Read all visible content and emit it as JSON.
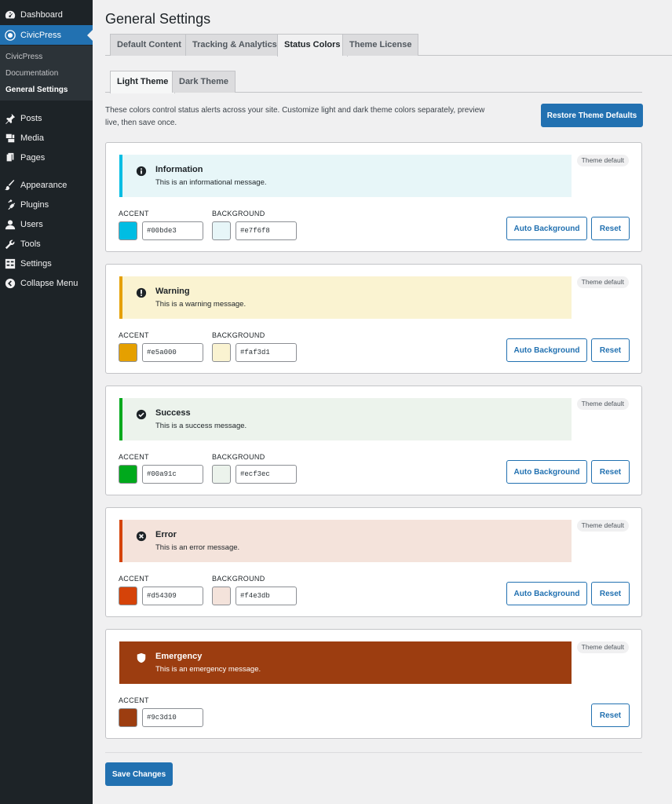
{
  "sidebar": {
    "items": [
      {
        "label": "Dashboard",
        "icon": "dashboard-icon"
      },
      {
        "label": "CivicPress",
        "icon": "civicpress-icon",
        "active": true
      }
    ],
    "submenu": [
      "CivicPress",
      "Documentation",
      "General Settings"
    ],
    "lower_items": [
      {
        "label": "Posts",
        "icon": "pin-icon"
      },
      {
        "label": "Media",
        "icon": "media-icon"
      },
      {
        "label": "Pages",
        "icon": "pages-icon"
      },
      {
        "label": "Appearance",
        "icon": "brush-icon"
      },
      {
        "label": "Plugins",
        "icon": "plug-icon"
      },
      {
        "label": "Users",
        "icon": "user-icon"
      },
      {
        "label": "Tools",
        "icon": "wrench-icon"
      },
      {
        "label": "Settings",
        "icon": "settings-icon"
      },
      {
        "label": "Collapse Menu",
        "icon": "collapse-icon"
      }
    ]
  },
  "page": {
    "title": "General Settings",
    "tabs": [
      "Default Content",
      "Tracking & Analytics",
      "Status Colors",
      "Theme License"
    ],
    "active_tab": "Status Colors",
    "subtabs": [
      "Light Theme",
      "Dark Theme"
    ],
    "active_subtab": "Light Theme",
    "description": "These colors control status alerts across your site. Customize light and dark theme colors separately, preview live, then save once.",
    "restore_label": "Restore Theme Defaults",
    "save_label": "Save Changes"
  },
  "labels": {
    "accent": "ACCENT",
    "background": "BACKGROUND",
    "auto_background": "Auto Background",
    "reset": "Reset",
    "theme_default": "Theme default"
  },
  "statuses": [
    {
      "title": "Information",
      "message": "This is an informational message.",
      "icon": "info-icon",
      "accent": "#00bde3",
      "background": "#e7f6f8",
      "text_color": "#1d2327"
    },
    {
      "title": "Warning",
      "message": "This is a warning message.",
      "icon": "warning-icon",
      "accent": "#e5a000",
      "background": "#faf3d1",
      "text_color": "#1d2327"
    },
    {
      "title": "Success",
      "message": "This is a success message.",
      "icon": "check-icon",
      "accent": "#00a91c",
      "background": "#ecf3ec",
      "text_color": "#1d2327"
    },
    {
      "title": "Error",
      "message": "This is an error message.",
      "icon": "error-icon",
      "accent": "#d54309",
      "background": "#f4e3db",
      "text_color": "#1d2327"
    },
    {
      "title": "Emergency",
      "message": "This is an emergency message.",
      "icon": "shield-icon",
      "accent": "#9c3d10",
      "background": "#9c3d10",
      "text_color": "#ffffff"
    }
  ]
}
